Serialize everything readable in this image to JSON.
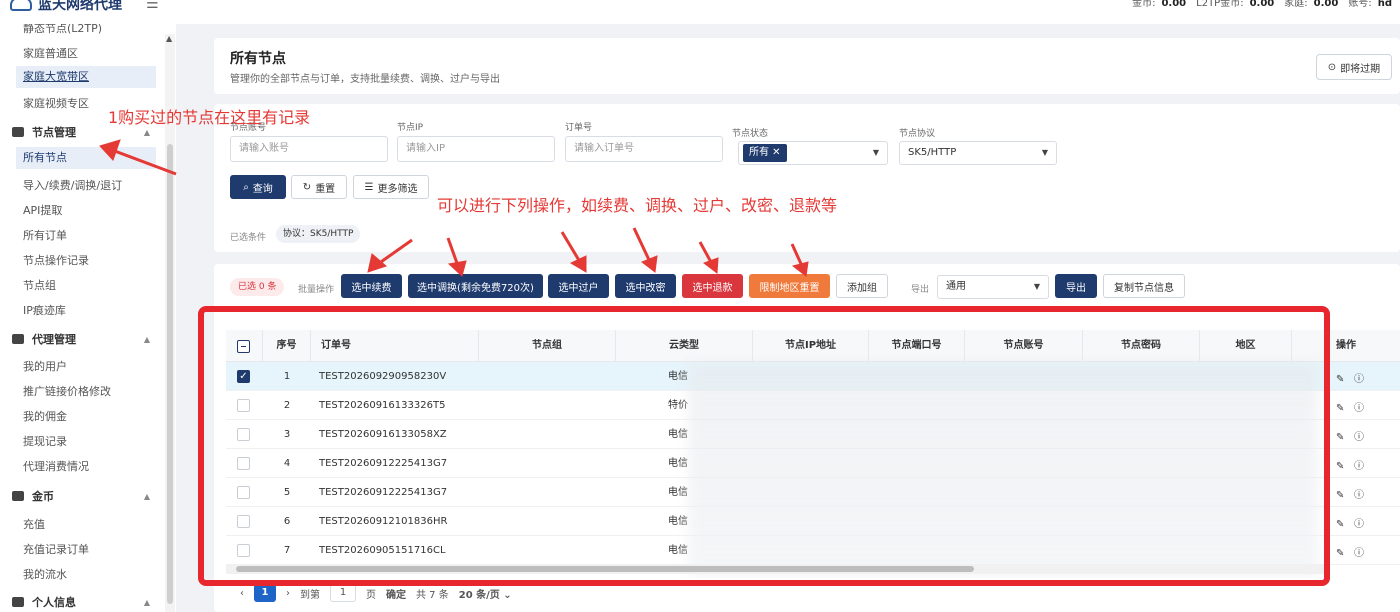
{
  "app": {
    "name": "蓝天网络代理",
    "menu_icon": "hamburger-icon"
  },
  "topbar": {
    "stats": [
      {
        "label": "金币:",
        "value": "0.00"
      },
      {
        "label": "L2TP金币:",
        "value": "0.00"
      },
      {
        "label": "家庭:",
        "value": "0.00"
      },
      {
        "label": "账号:",
        "value": "hd"
      }
    ]
  },
  "sidebar": {
    "items_top": [
      "静态节点(L2TP)",
      "家庭普通区",
      "家庭大宽带区",
      "家庭视频专区"
    ],
    "sections": [
      {
        "title": "节点管理",
        "icon": "server-icon",
        "items": [
          "所有节点",
          "导入/续费/调换/退订",
          "API提取",
          "所有订单",
          "节点操作记录",
          "节点组",
          "IP痕迹库"
        ]
      },
      {
        "title": "代理管理",
        "icon": "users-icon",
        "items": [
          "我的用户",
          "推广链接价格修改",
          "我的佣金",
          "提现记录",
          "代理消费情况"
        ]
      },
      {
        "title": "金币",
        "icon": "wallet-icon",
        "items": [
          "充值",
          "充值记录订单",
          "我的流水"
        ]
      },
      {
        "title": "个人信息",
        "icon": "user-icon",
        "items": []
      }
    ]
  },
  "header": {
    "title": "所有节点",
    "subtitle": "管理你的全部节点与订单，支持批量续费、调换、过户与导出",
    "expire_btn": "即将过期"
  },
  "filters": {
    "account": {
      "label": "节点账号",
      "placeholder": "请输入账号"
    },
    "ip": {
      "label": "节点IP",
      "placeholder": "请输入IP"
    },
    "order": {
      "label": "订单号",
      "placeholder": "请输入订单号"
    },
    "status": {
      "label": "节点状态",
      "chip": "所有"
    },
    "protocol": {
      "label": "节点协议",
      "value": "SK5/HTTP"
    },
    "query_btn": "查询",
    "reset_btn": "重置",
    "more_btn": "更多筛选",
    "cond_label": "已选条件",
    "cond_chip": "协议：SK5/HTTP"
  },
  "batch": {
    "selected": "已选 0 条",
    "label": "批量操作",
    "buttons": [
      "选中续费",
      "选中调换(剩余免费720次)",
      "选中过户",
      "选中改密",
      "选中退款",
      "限制地区重置"
    ],
    "add_group": "添加组",
    "export_label": "导出",
    "export_select": "通用",
    "export_btn": "导出",
    "copy_btn": "复制节点信息"
  },
  "table": {
    "columns": [
      "序号",
      "订单号",
      "节点组",
      "云类型",
      "节点IP地址",
      "节点端口号",
      "节点账号",
      "节点密码",
      "地区",
      "操作"
    ],
    "rows": [
      {
        "no": "1",
        "order": "TEST202609290958230V",
        "cloud": "电信",
        "checked": true
      },
      {
        "no": "2",
        "order": "TEST20260916133326T5",
        "cloud": "特价",
        "checked": false
      },
      {
        "no": "3",
        "order": "TEST20260916133058XZ",
        "cloud": "电信",
        "checked": false
      },
      {
        "no": "4",
        "order": "TEST20260912225413G7",
        "cloud": "电信",
        "checked": false
      },
      {
        "no": "5",
        "order": "TEST20260912225413G7",
        "cloud": "电信",
        "checked": false
      },
      {
        "no": "6",
        "order": "TEST20260912101836HR",
        "cloud": "电信",
        "checked": false
      },
      {
        "no": "7",
        "order": "TEST20260905151716CL",
        "cloud": "电信",
        "checked": false
      }
    ],
    "action_icons": [
      "edit-icon",
      "info-icon"
    ]
  },
  "pager": {
    "current": "1",
    "goto": "到第",
    "page_input": "1",
    "page_unit": "页",
    "confirm": "确定",
    "total": "共 7 条",
    "size": "20 条/页"
  },
  "annotations": {
    "a1": "1购买过的节点在这里有记录",
    "a2": "可以进行下列操作，如续费、调换、过户、改密、退款等",
    "color": "#e53935"
  },
  "colors": {
    "primary": "#1f3b6e",
    "danger": "#d9363e",
    "warning": "#f07a3c"
  }
}
